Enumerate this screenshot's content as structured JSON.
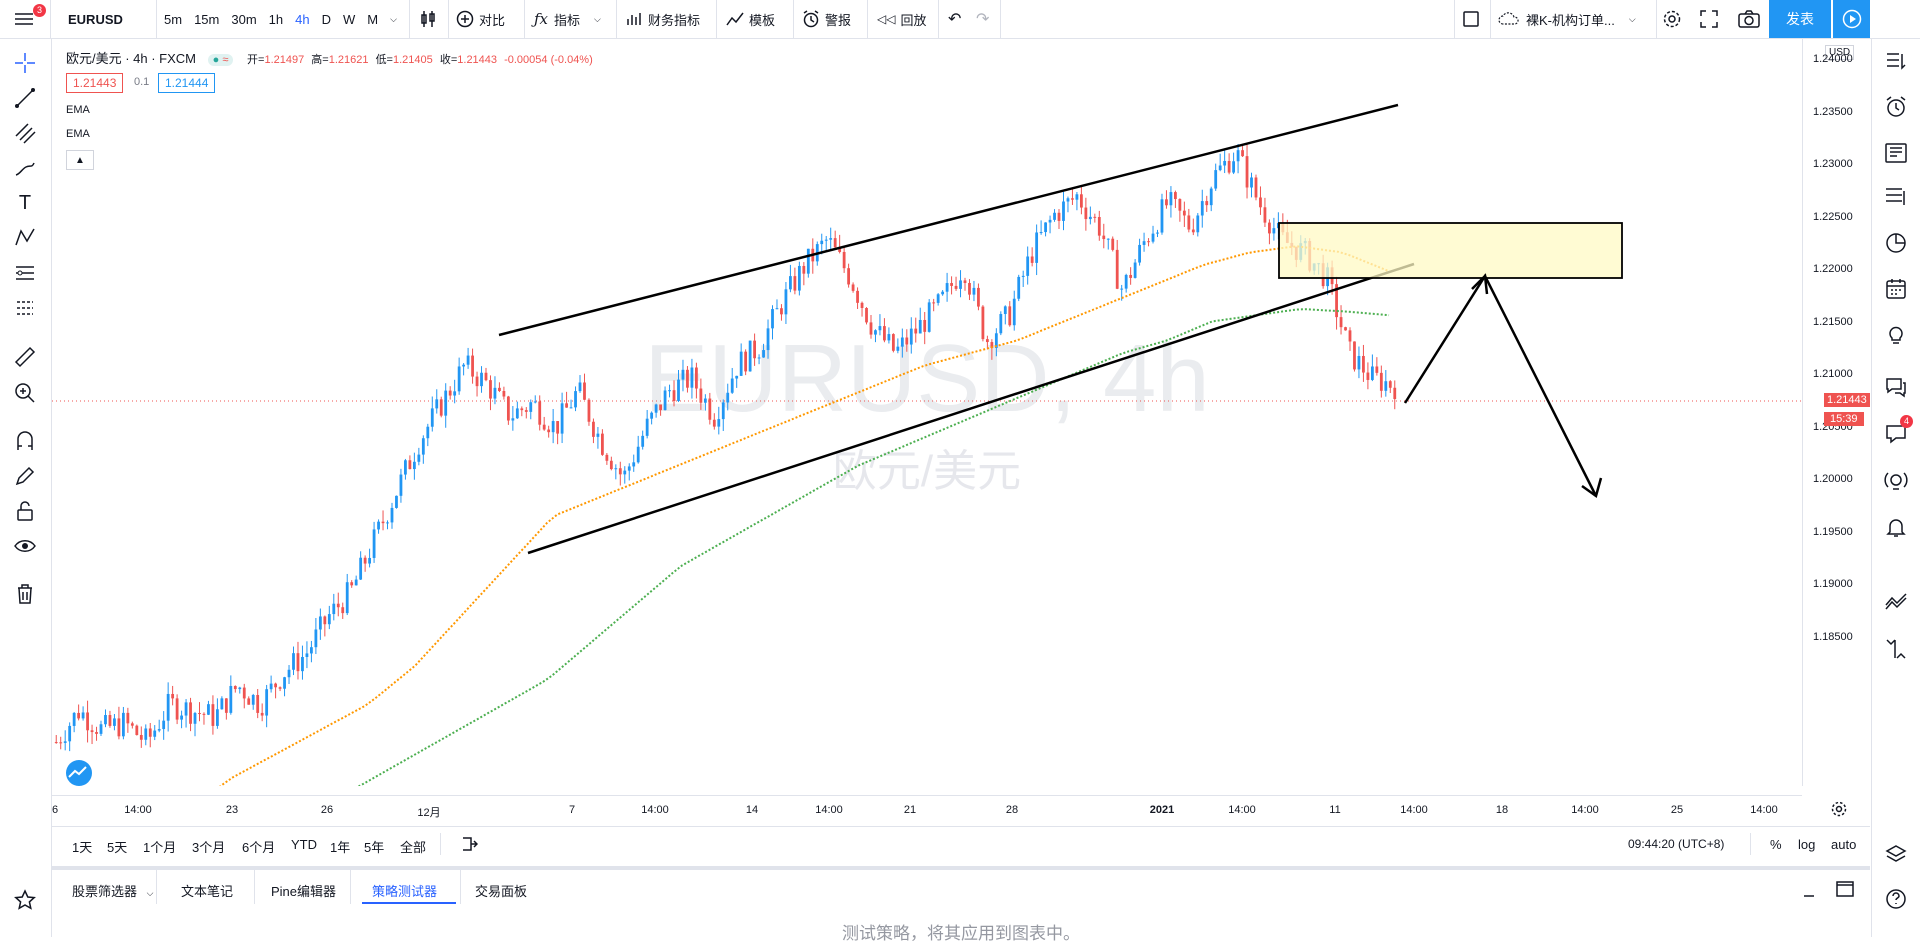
{
  "toolbar": {
    "menu_badge": "3",
    "symbol": "EURUSD",
    "intervals": [
      "5m",
      "15m",
      "30m",
      "1h",
      "4h",
      "D",
      "W",
      "M"
    ],
    "active_interval": "4h",
    "compare": "对比",
    "indicators": "指标",
    "financials": "财务指标",
    "templates": "模板",
    "alerts": "警报",
    "replay": "回放",
    "layout_name": "裸K-机构订单...",
    "publish": "发表"
  },
  "legend": {
    "name": "欧元/美元 · 4h · FXCM",
    "open_label": "开=",
    "open": "1.21497",
    "high_label": "高=",
    "high": "1.21621",
    "low_label": "低=",
    "low": "1.21405",
    "close_label": "收=",
    "close": "1.21443",
    "change": "-0.00054 (-0.04%)",
    "bid": "1.21443",
    "spread": "0.1",
    "ask": "1.21444",
    "indicators": [
      "EMA",
      "EMA"
    ]
  },
  "watermark": {
    "symbol": "EURUSD, 4h",
    "name": "欧元/美元"
  },
  "price_axis": {
    "currency": "USD",
    "labels": [
      "1.24000",
      "1.23500",
      "1.23000",
      "1.22500",
      "1.22000",
      "1.21500",
      "1.21000",
      "1.20500",
      "1.20000",
      "1.19500",
      "1.19000",
      "1.18500"
    ],
    "current_price": "1.21443",
    "countdown": "15:39"
  },
  "time_axis": [
    "6",
    "14:00",
    "23",
    "26",
    "12月",
    "7",
    "14:00",
    "14",
    "14:00",
    "21",
    "28",
    "2021",
    "14:00",
    "11",
    "14:00",
    "18",
    "14:00",
    "25",
    "14:00"
  ],
  "range_bar": {
    "ranges": [
      "1天",
      "5天",
      "1个月",
      "3个月",
      "6个月",
      "YTD",
      "1年",
      "5年",
      "全部"
    ],
    "clock": "09:44:20 (UTC+8)",
    "percent": "%",
    "log": "log",
    "auto": "auto"
  },
  "bottom_panel": {
    "tabs": [
      "股票筛选器",
      "文本笔记",
      "Pine编辑器",
      "策略测试器",
      "交易面板"
    ],
    "active_tab": "策略测试器",
    "hint": "测试策略，将其应用到图表中。"
  },
  "right_badge": "4",
  "colors": {
    "up": "#2196f3",
    "down": "#ef5350",
    "ema_fast": "#ff9800",
    "ema_slow": "#4caf50",
    "accent": "#2196f3",
    "zone": "#fff9c4"
  },
  "chart_data": {
    "type": "candlestick",
    "symbol": "EURUSD",
    "timeframe": "4h",
    "ylim": [
      1.1825,
      1.242
    ],
    "last_close": 1.21443,
    "price_path": [
      1.186,
      1.1885,
      1.187,
      1.1875,
      1.186,
      1.189,
      1.1885,
      1.188,
      1.1905,
      1.189,
      1.1915,
      1.193,
      1.196,
      1.198,
      1.202,
      1.206,
      1.21,
      1.213,
      1.216,
      1.2145,
      1.212,
      1.213,
      1.211,
      1.214,
      1.21,
      1.207,
      1.211,
      1.214,
      1.215,
      1.212,
      1.216,
      1.2175,
      1.221,
      1.224,
      1.226,
      1.223,
      1.219,
      1.217,
      1.219,
      1.221,
      1.224,
      1.218,
      1.22,
      1.225,
      1.228,
      1.2295,
      1.227,
      1.222,
      1.226,
      1.229,
      1.227,
      1.231,
      1.233,
      1.229,
      1.226,
      1.225,
      1.223,
      1.217,
      1.215,
      1.2144
    ],
    "ema_fast_path": [
      1.18,
      1.183,
      1.185,
      1.187,
      1.189,
      1.192,
      1.196,
      1.2,
      1.204,
      1.2055,
      1.207,
      1.2085,
      1.21,
      1.2115,
      1.213,
      1.2145,
      1.216,
      1.217,
      1.218,
      1.2195,
      1.221,
      1.2225,
      1.224,
      1.225,
      1.2255,
      1.225,
      1.2235
    ],
    "ema_slow_path": [
      1.179,
      1.181,
      1.183,
      1.185,
      1.187,
      1.189,
      1.191,
      1.194,
      1.197,
      1.2,
      1.202,
      1.204,
      1.206,
      1.208,
      1.2095,
      1.211,
      1.2125,
      1.214,
      1.2155,
      1.217,
      1.218,
      1.2195,
      1.22,
      1.2205,
      1.2203,
      1.22
    ]
  }
}
